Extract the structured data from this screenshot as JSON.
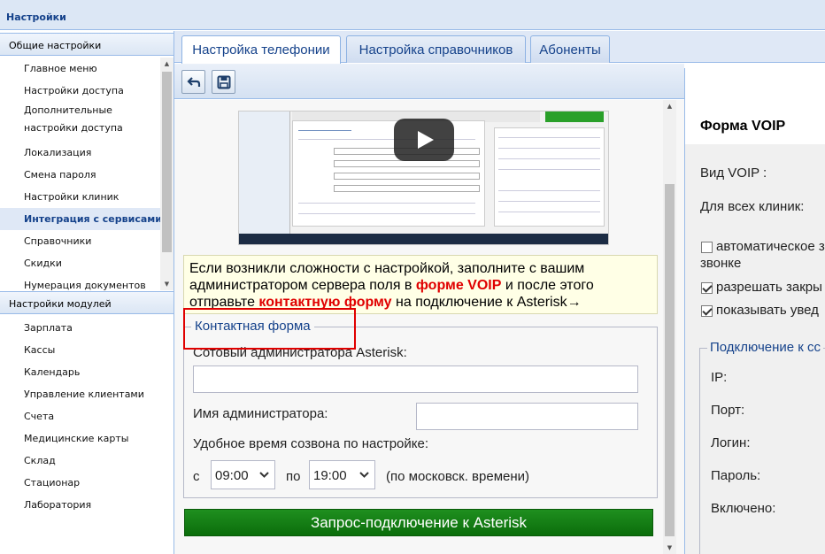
{
  "window": {
    "title": "Настройки"
  },
  "sidebar": {
    "general_header": "Общие настройки",
    "general_items": [
      {
        "label": "Главное меню"
      },
      {
        "label": "Настройки доступа"
      },
      {
        "label": "Дополнительные настройки доступа"
      },
      {
        "label": "Локализация"
      },
      {
        "label": "Смена пароля"
      },
      {
        "label": "Настройки клиник"
      },
      {
        "label": "Интеграция с сервисами",
        "active": true
      },
      {
        "label": "Справочники"
      },
      {
        "label": "Скидки"
      },
      {
        "label": "Нумерация документов"
      }
    ],
    "modules_header": "Настройки модулей",
    "module_items": [
      {
        "label": "Зарплата"
      },
      {
        "label": "Кассы"
      },
      {
        "label": "Календарь"
      },
      {
        "label": "Управление клиентами"
      },
      {
        "label": "Счета"
      },
      {
        "label": "Медицинские карты"
      },
      {
        "label": "Склад"
      },
      {
        "label": "Стационар"
      },
      {
        "label": "Лаборатория"
      }
    ]
  },
  "tabs": [
    {
      "label": "Настройка телефонии",
      "active": true
    },
    {
      "label": "Настройка справочников"
    },
    {
      "label": "Абоненты"
    }
  ],
  "toolbar": {
    "back_icon": "back-arrow-icon",
    "save_icon": "save-icon"
  },
  "notice": {
    "part1": "Если возникли сложности с настройкой, заполните с вашим администратором сервера поля в ",
    "link1": "форме VOIP",
    "part2": " и после этого отправьте ",
    "link2": "контактную форму",
    "part3": " на подключение к Asterisk→"
  },
  "contact_form": {
    "legend": "Контактная форма",
    "phone_label": "Сотовый администратора Asterisk:",
    "phone_value": "",
    "name_label": "Имя администратора:",
    "name_value": "",
    "time_label": "Удобное время созвона по настройке:",
    "from_label": "с",
    "from_value": "09:00",
    "to_label": "по",
    "to_value": "19:00",
    "tz_note": "(по московск. времени)",
    "submit_label": "Запрос-подключение к Asterisk"
  },
  "voip_form": {
    "title": "Форма VOIP",
    "voip_type_label": "Вид VOIP :",
    "all_clinics_label": "Для всех клиник:",
    "checkbox_auto_label_1": "автоматическое з",
    "checkbox_auto_label_2": "звонке",
    "checkbox_auto": false,
    "checkbox_close_label": "разрешать закры",
    "checkbox_close": true,
    "checkbox_show_label": "показывать увед",
    "checkbox_show": true,
    "connection_legend": "Подключение к сс",
    "ip_label": "IP:",
    "port_label": "Порт:",
    "login_label": "Логин:",
    "password_label": "Пароль:",
    "enabled_label": "Включено:"
  }
}
